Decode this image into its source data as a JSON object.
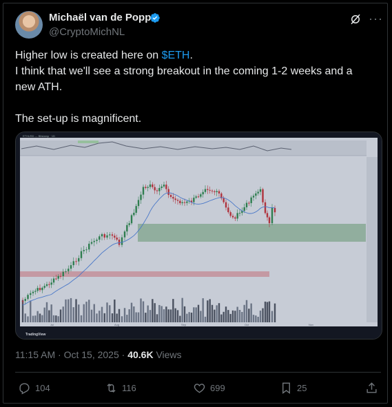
{
  "author": {
    "display_name": "Michaël van de Poppe",
    "handle": "@CryptoMichNL",
    "verified": true
  },
  "tweet": {
    "line1_before": "Higher low is created here on ",
    "cashtag": "$ETH",
    "line1_after": ".",
    "line2": "I think that we'll see a strong breakout in the coming 1-2 weeks and a new ATH.",
    "line3": "The set-up is magnificent."
  },
  "chart": {
    "header_text": "ETHUSD — Bitstamp · 1D",
    "watermark": "TradingView",
    "x_labels": [
      "Jul",
      "Aug",
      "Sep",
      "Oct",
      "Nov"
    ]
  },
  "meta": {
    "time": "11:15 AM",
    "sep": "·",
    "date": "Oct 15, 2025",
    "sep2": "·",
    "views_count": "40.6K",
    "views_label": "Views"
  },
  "actions": {
    "replies": "104",
    "reposts": "116",
    "likes": "699",
    "bookmarks": "25"
  },
  "colors": {
    "background": "#000000",
    "text": "#e7e9ea",
    "muted": "#71767b",
    "link": "#1d9bf0",
    "verified": "#1d9bf0"
  },
  "icons": {
    "reply": "reply-icon",
    "repost": "repost-icon",
    "like": "heart-icon",
    "bookmark": "bookmark-icon",
    "share": "share-icon",
    "grok": "grok-icon",
    "more": "more-icon"
  }
}
